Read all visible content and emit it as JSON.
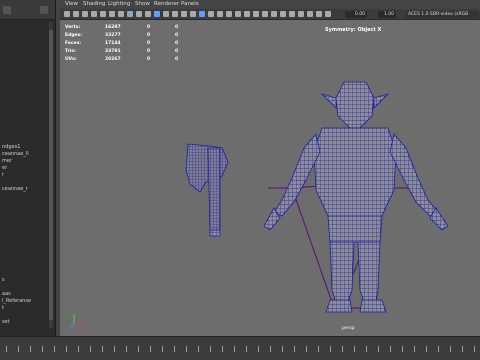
{
  "outliner": {
    "items": [
      "",
      "",
      "",
      "",
      "",
      "",
      "",
      "",
      "",
      "",
      "",
      "",
      "",
      "",
      "",
      "",
      "",
      "ndges1",
      "ceannae_ll",
      "mer",
      "er",
      "r",
      "",
      "ceannae_r",
      "",
      "",
      "",
      "",
      "",
      "",
      "",
      "",
      "",
      "",
      "",
      "",
      "s",
      "",
      "aas",
      "l_Referanse",
      "t",
      "",
      "set"
    ]
  },
  "menu": {
    "items": [
      "View",
      "Shading",
      "Lighting",
      "Show",
      "Renderer",
      "Panels"
    ]
  },
  "toolbar": {
    "field1": "0.00",
    "field2": "1.00",
    "colorspace": "ACES 1.0 SDR-video (sRGB"
  },
  "hud": {
    "rows": [
      {
        "label": "Verts:",
        "v1": "16287",
        "v2": "0",
        "v3": "0"
      },
      {
        "label": "Edges:",
        "v1": "33277",
        "v2": "0",
        "v3": "0"
      },
      {
        "label": "Faces:",
        "v1": "17144",
        "v2": "0",
        "v3": "0"
      },
      {
        "label": "Tris:",
        "v1": "33781",
        "v2": "0",
        "v3": "0"
      },
      {
        "label": "UVs:",
        "v1": "20267",
        "v2": "0",
        "v3": "0"
      }
    ]
  },
  "viewport": {
    "symmetry": "Symmetry: Object X",
    "camera": "persp"
  },
  "colors": {
    "viewport_bg": "#6d6d6d",
    "wire": "#1b1f9e",
    "bone": "#5a1070",
    "accent_blue": "#5aa0ff"
  },
  "timeline": {
    "labels": [
      "",
      "",
      "",
      "",
      "",
      "",
      "",
      "",
      "",
      "",
      "",
      "",
      ""
    ]
  }
}
